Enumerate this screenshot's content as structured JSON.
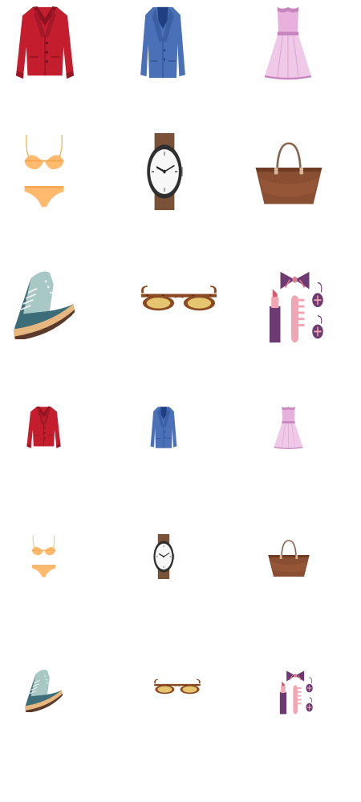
{
  "colors": {
    "background": "#ffffff",
    "jacket_red": "#c41e2e",
    "blazer_blue": "#4a70b8",
    "dress_pink": "#f0c8e8",
    "lingerie_orange": "#ffba6e",
    "watch_brown": "#7a5238",
    "bag_brown": "#8a4f32",
    "sneaker_teal": "#3d6d78",
    "sunglass_tortoise": "#8a4a22",
    "accessory_purple": "#6e3a72"
  },
  "icon_grid": {
    "sets": [
      {
        "size": "large",
        "items": [
          "red-jacket-icon",
          "blue-blazer-icon",
          "pink-dress-icon",
          "bikini-icon",
          "wristwatch-icon",
          "handbag-icon",
          "sneaker-icon",
          "sunglasses-icon",
          "cosmetics-accessories-icon"
        ]
      },
      {
        "size": "small",
        "items": [
          "red-jacket-icon",
          "blue-blazer-icon",
          "pink-dress-icon",
          "bikini-icon",
          "wristwatch-icon",
          "handbag-icon",
          "sneaker-icon",
          "sunglasses-icon",
          "cosmetics-accessories-icon"
        ]
      }
    ]
  }
}
